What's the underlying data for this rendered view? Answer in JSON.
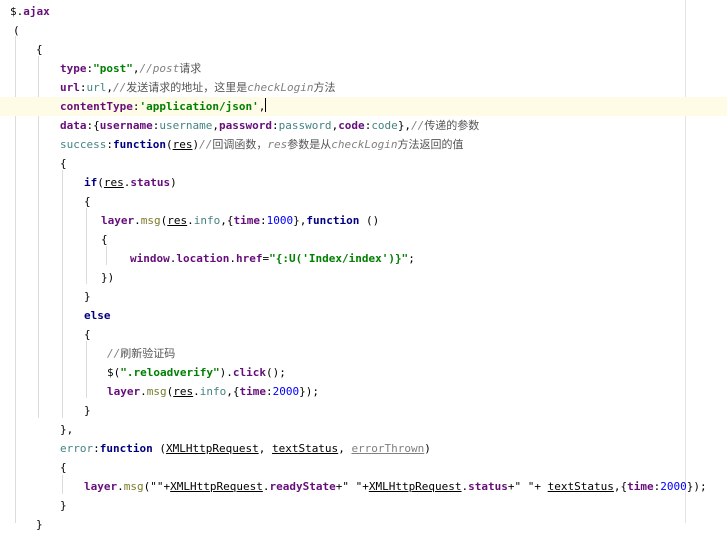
{
  "editor": {
    "lines": [
      [
        {
          "t": "$.",
          "c": "plain"
        },
        {
          "t": "ajax",
          "c": "prop"
        }
      ],
      [
        {
          "t": "(",
          "c": "plain"
        }
      ],
      [
        {
          "t": "{",
          "c": "plain"
        }
      ],
      [
        {
          "t": "type",
          "c": "prop"
        },
        {
          "t": ":",
          "c": "plain"
        },
        {
          "t": "\"post\"",
          "c": "str"
        },
        {
          "t": ",",
          "c": "plain"
        },
        {
          "t": "//post",
          "c": "cm"
        },
        {
          "t": "请求",
          "c": "cm-zh"
        }
      ],
      [
        {
          "t": "url",
          "c": "prop"
        },
        {
          "t": ":",
          "c": "plain"
        },
        {
          "t": "url",
          "c": "ident"
        },
        {
          "t": ",",
          "c": "plain"
        },
        {
          "t": "//",
          "c": "cm"
        },
        {
          "t": "发送请求的地址，这里是",
          "c": "cm-zh"
        },
        {
          "t": "checkLogin",
          "c": "cm"
        },
        {
          "t": "方法",
          "c": "cm-zh"
        }
      ],
      [
        {
          "t": "contentType",
          "c": "prop"
        },
        {
          "t": ":",
          "c": "plain"
        },
        {
          "t": "'application/json'",
          "c": "str"
        },
        {
          "t": ",",
          "c": "plain"
        }
      ],
      [
        {
          "t": "data",
          "c": "prop"
        },
        {
          "t": ":{",
          "c": "plain"
        },
        {
          "t": "username",
          "c": "prop"
        },
        {
          "t": ":",
          "c": "plain"
        },
        {
          "t": "username",
          "c": "ident"
        },
        {
          "t": ",",
          "c": "plain"
        },
        {
          "t": "password",
          "c": "prop"
        },
        {
          "t": ":",
          "c": "plain"
        },
        {
          "t": "password",
          "c": "ident"
        },
        {
          "t": ",",
          "c": "plain"
        },
        {
          "t": "code",
          "c": "prop"
        },
        {
          "t": ":",
          "c": "plain"
        },
        {
          "t": "code",
          "c": "ident"
        },
        {
          "t": "},",
          "c": "plain"
        },
        {
          "t": "//",
          "c": "cm"
        },
        {
          "t": "传递的参数",
          "c": "cm-zh"
        }
      ],
      [
        {
          "t": "success",
          "c": "ident"
        },
        {
          "t": ":",
          "c": "plain"
        },
        {
          "t": "function",
          "c": "kw"
        },
        {
          "t": "(",
          "c": "plain"
        },
        {
          "t": "res",
          "c": "param"
        },
        {
          "t": ")",
          "c": "plain"
        },
        {
          "t": "//",
          "c": "cm"
        },
        {
          "t": "回调函数，",
          "c": "cm-zh"
        },
        {
          "t": "res",
          "c": "cm"
        },
        {
          "t": "参数是从",
          "c": "cm-zh"
        },
        {
          "t": "checkLogin",
          "c": "cm"
        },
        {
          "t": "方法返回的值",
          "c": "cm-zh"
        }
      ],
      [
        {
          "t": "{",
          "c": "plain"
        }
      ],
      [
        {
          "t": "if",
          "c": "kw"
        },
        {
          "t": "(",
          "c": "plain"
        },
        {
          "t": "res",
          "c": "param"
        },
        {
          "t": ".",
          "c": "plain"
        },
        {
          "t": "status",
          "c": "prop"
        },
        {
          "t": ")",
          "c": "plain"
        }
      ],
      [
        {
          "t": "{",
          "c": "plain"
        }
      ],
      [
        {
          "t": "layer",
          "c": "prop"
        },
        {
          "t": ".",
          "c": "plain"
        },
        {
          "t": "msg",
          "c": "fn"
        },
        {
          "t": "(",
          "c": "plain"
        },
        {
          "t": "res",
          "c": "param"
        },
        {
          "t": ".",
          "c": "plain"
        },
        {
          "t": "info",
          "c": "ident"
        },
        {
          "t": ",{",
          "c": "plain"
        },
        {
          "t": "time",
          "c": "prop"
        },
        {
          "t": ":",
          "c": "plain"
        },
        {
          "t": "1000",
          "c": "num"
        },
        {
          "t": "},",
          "c": "plain"
        },
        {
          "t": "function",
          "c": "kw"
        },
        {
          "t": " ()",
          "c": "plain"
        }
      ],
      [
        {
          "t": "{",
          "c": "plain"
        }
      ],
      [
        {
          "t": "window",
          "c": "prop"
        },
        {
          "t": ".",
          "c": "plain"
        },
        {
          "t": "location",
          "c": "prop"
        },
        {
          "t": ".",
          "c": "plain"
        },
        {
          "t": "href",
          "c": "prop"
        },
        {
          "t": "=",
          "c": "plain"
        },
        {
          "t": "\"{:U('Index/index')}\"",
          "c": "str"
        },
        {
          "t": ";",
          "c": "plain"
        }
      ],
      [
        {
          "t": "})",
          "c": "plain"
        }
      ],
      [
        {
          "t": "}",
          "c": "plain"
        }
      ],
      [
        {
          "t": "else",
          "c": "kw"
        }
      ],
      [
        {
          "t": "{",
          "c": "plain"
        }
      ],
      [
        {
          "t": "//",
          "c": "cm"
        },
        {
          "t": "刷新验证码",
          "c": "cm-zh"
        }
      ],
      [
        {
          "t": "$(",
          "c": "plain"
        },
        {
          "t": "\".reloadverify\"",
          "c": "str"
        },
        {
          "t": ").",
          "c": "plain"
        },
        {
          "t": "click",
          "c": "prop"
        },
        {
          "t": "();",
          "c": "plain"
        }
      ],
      [
        {
          "t": "layer",
          "c": "prop"
        },
        {
          "t": ".",
          "c": "plain"
        },
        {
          "t": "msg",
          "c": "fn"
        },
        {
          "t": "(",
          "c": "plain"
        },
        {
          "t": "res",
          "c": "param"
        },
        {
          "t": ".",
          "c": "plain"
        },
        {
          "t": "info",
          "c": "ident"
        },
        {
          "t": ",{",
          "c": "plain"
        },
        {
          "t": "time",
          "c": "prop"
        },
        {
          "t": ":",
          "c": "plain"
        },
        {
          "t": "2000",
          "c": "num"
        },
        {
          "t": "});",
          "c": "plain"
        }
      ],
      [
        {
          "t": "}",
          "c": "plain"
        }
      ],
      [
        {
          "t": "},",
          "c": "plain"
        }
      ],
      [
        {
          "t": "error",
          "c": "ident"
        },
        {
          "t": ":",
          "c": "plain"
        },
        {
          "t": "function",
          "c": "kw"
        },
        {
          "t": " (",
          "c": "plain"
        },
        {
          "t": "XMLHttpRequest",
          "c": "param"
        },
        {
          "t": ", ",
          "c": "plain"
        },
        {
          "t": "textStatus",
          "c": "param"
        },
        {
          "t": ", ",
          "c": "plain"
        },
        {
          "t": "errorThrown",
          "c": "unused"
        },
        {
          "t": ")",
          "c": "plain"
        }
      ],
      [
        {
          "t": "{",
          "c": "plain"
        }
      ],
      [
        {
          "t": "layer",
          "c": "prop"
        },
        {
          "t": ".",
          "c": "plain"
        },
        {
          "t": "msg",
          "c": "fn"
        },
        {
          "t": "(\"\"+",
          "c": "plain"
        },
        {
          "t": "XMLHttpRequest",
          "c": "param"
        },
        {
          "t": ".",
          "c": "plain"
        },
        {
          "t": "readyState",
          "c": "prop"
        },
        {
          "t": "+\" \"+",
          "c": "plain"
        },
        {
          "t": "XMLHttpRequest",
          "c": "param"
        },
        {
          "t": ".",
          "c": "plain"
        },
        {
          "t": "status",
          "c": "prop"
        },
        {
          "t": "+\" \"+ ",
          "c": "plain"
        },
        {
          "t": "textStatus",
          "c": "param"
        },
        {
          "t": ",{",
          "c": "plain"
        },
        {
          "t": "time",
          "c": "prop"
        },
        {
          "t": ":",
          "c": "plain"
        },
        {
          "t": "2000",
          "c": "num"
        },
        {
          "t": "});",
          "c": "plain"
        }
      ],
      [
        {
          "t": "}",
          "c": "plain"
        }
      ],
      [
        {
          "t": "}",
          "c": "plain"
        }
      ]
    ],
    "current_line_index": 5
  }
}
